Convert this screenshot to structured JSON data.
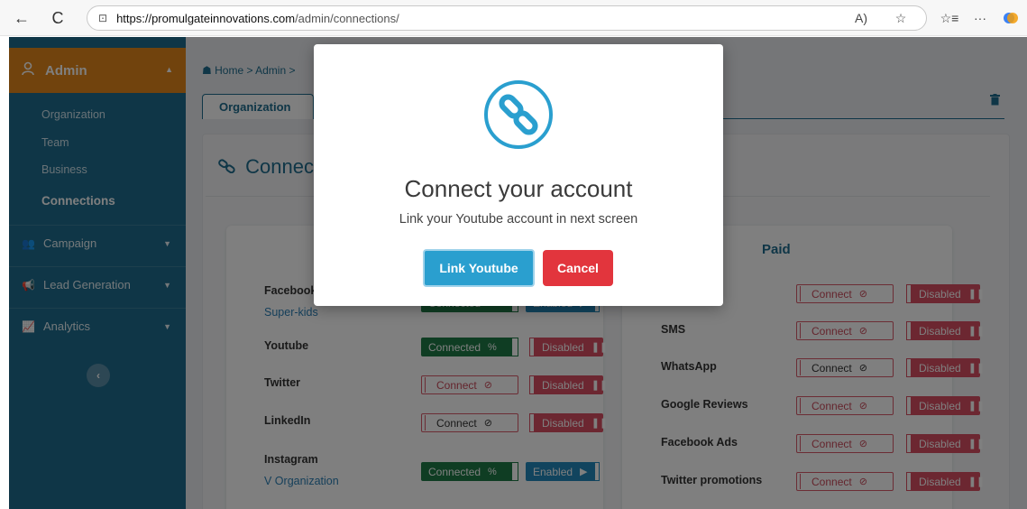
{
  "browser": {
    "url_host": "https://promulgateinnovations.com",
    "url_path": "/admin/connections/",
    "back_glyph": "←",
    "refresh_glyph": "C",
    "lock_glyph": "⊡",
    "read_aloud_glyph": "A)",
    "favorite_glyph": "☆",
    "collections_glyph": "☆≡",
    "more_glyph": "···"
  },
  "sidebar": {
    "header": {
      "label": "Admin",
      "icon": "user-icon",
      "caret": "▲"
    },
    "sub_items": [
      {
        "label": "Organization",
        "active": false
      },
      {
        "label": "Team",
        "active": false
      },
      {
        "label": "Business",
        "active": false
      },
      {
        "label": "Connections",
        "active": true
      }
    ],
    "items": [
      {
        "label": "Campaign",
        "icon": "users-icon",
        "glyph": "👥",
        "caret": "▼"
      },
      {
        "label": "Lead Generation",
        "icon": "megaphone-icon",
        "glyph": "📢",
        "caret": "▼"
      },
      {
        "label": "Analytics",
        "icon": "line-chart-icon",
        "glyph": "📈",
        "caret": "▼"
      }
    ],
    "collapse_glyph": "‹"
  },
  "breadcrumb": {
    "home_glyph": "☗",
    "text": "Home > Admin >"
  },
  "tabs": {
    "organization": "Organization"
  },
  "main": {
    "title": "Connect",
    "title_icon": "link-icon",
    "paid_title": "Paid"
  },
  "left_rows": [
    {
      "name": "Facebook",
      "sub": "Super-kids"
    },
    {
      "name": "Youtube",
      "sub": ""
    },
    {
      "name": "Twitter",
      "sub": ""
    },
    {
      "name": "LinkedIn",
      "sub": ""
    },
    {
      "name": "Instagram",
      "sub": "V Organization"
    }
  ],
  "right_rows": [
    {
      "name": "SMS"
    },
    {
      "name": "WhatsApp"
    },
    {
      "name": "Google Reviews"
    },
    {
      "name": "Facebook Ads"
    },
    {
      "name": "Twitter promotions"
    }
  ],
  "status_labels": {
    "connected": "Connected",
    "connect": "Connect",
    "disabled": "Disabled",
    "enabled": "Enabled",
    "link_glyph": "%",
    "unlink_glyph": "⊘",
    "pause_glyph": "❚❚",
    "play_glyph": "▶"
  },
  "modal": {
    "title": "Connect your account",
    "message": "Link your Youtube account in next screen",
    "primary_label": "Link Youtube",
    "cancel_label": "Cancel",
    "icon": "link-circle-icon",
    "accent": "#2a9fcf"
  },
  "colors": {
    "sidebar": "#1f6d8e",
    "admin_header": "#e3871a",
    "connected": "#1e7a46",
    "disabled": "#d94f62",
    "enabled": "#2289bd",
    "cancel": "#e2353d"
  }
}
